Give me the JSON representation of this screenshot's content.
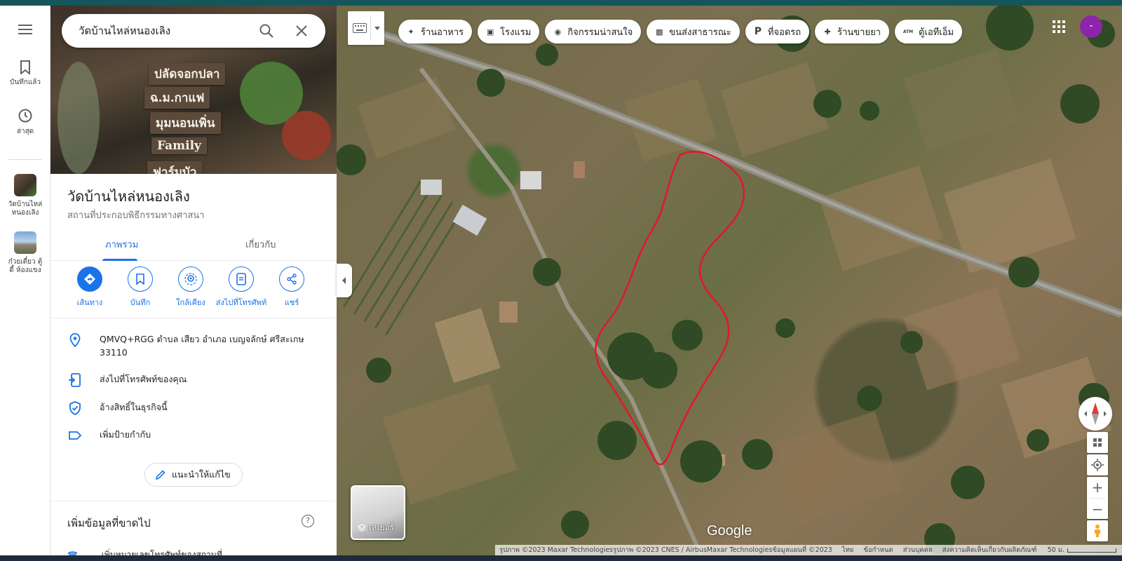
{
  "search": {
    "value": "วัดบ้านไหล่หนองเลิง"
  },
  "rail": {
    "saved_label": "บันทึกแล้ว",
    "recent_label": "ล่าสุด",
    "recent_items": [
      {
        "label_line1": "วัดบ้านไหล่",
        "label_line2": "หนองเลิง"
      },
      {
        "label_line1": "ก๋วยเตี๋ยว ตู้",
        "label_line2": "ดี้ ห้องแขง"
      }
    ]
  },
  "hero": {
    "signs": [
      "ปลัดจอกปลา",
      "ฉ.ม.กาแฟ",
      "มุมนอนเพิ่น",
      "Family",
      "ฟาร์มบัว"
    ]
  },
  "place": {
    "title": "วัดบ้านไหล่หนองเลิง",
    "category": "สถานที่ประกอบพิธีกรรมทางศาสนา"
  },
  "tabs": [
    {
      "label": "ภาพรวม",
      "active": true
    },
    {
      "label": "เกี่ยวกับ",
      "active": false
    }
  ],
  "actions": [
    {
      "label": "เส้นทาง",
      "icon": "directions-icon"
    },
    {
      "label": "บันทึก",
      "icon": "bookmark-icon"
    },
    {
      "label": "ใกล้เคียง",
      "icon": "nearby-icon"
    },
    {
      "label": "ส่งไปที่โทรศัพท์",
      "icon": "send-to-phone-icon"
    },
    {
      "label": "แชร์",
      "icon": "share-icon"
    }
  ],
  "info": {
    "address_line1": "QMVQ+RGG ตำบล เสียว อำเภอ เบญจลักษ์ ศรีสะเกษ",
    "address_line2": "33110",
    "send_to_phone": "ส่งไปที่โทรศัพท์ของคุณ",
    "claim": "อ้างสิทธิ์ในธุรกิจนี้",
    "add_label": "เพิ่มป้ายกำกับ"
  },
  "suggest_edit": "แนะนำให้แก้ไข",
  "missing_info": {
    "heading": "เพิ่มข้อมูลที่ขาดไป",
    "help": "?",
    "first_item": "เพิ่มหมายเลขโทรศัพท์ของสถานที่"
  },
  "chips": [
    {
      "label": "ร้านอาหาร",
      "icon": "restaurant-icon"
    },
    {
      "label": "โรงแรม",
      "icon": "hotel-icon"
    },
    {
      "label": "กิจกรรมน่าสนใจ",
      "icon": "camera-icon"
    },
    {
      "label": "ขนส่งสาธารณะ",
      "icon": "transit-icon"
    },
    {
      "label": "ที่จอดรถ",
      "icon": "parking-icon"
    },
    {
      "label": "ร้านขายยา",
      "icon": "pharmacy-icon"
    },
    {
      "label": "ตู้เอทีเอ็ม",
      "icon": "atm-icon",
      "badge": "ATM"
    }
  ],
  "avatar_initial": "-",
  "layers_label": "เลเยอร์",
  "google_logo": "Google",
  "attribution": {
    "imagery": "รูปภาพ ©2023 Maxar Technologiesรูปภาพ ©2023 CNES / AirbusMaxar Technologiesข้อมูลแผนที่ ©2023",
    "language": "ไทย",
    "terms": "ข้อกำหนด",
    "privacy": "ส่วนบุคคล",
    "feedback": "ส่งความคิดเห็นเกี่ยวกับผลิตภัณฑ์",
    "scale": "50 ม."
  },
  "colors": {
    "accent": "#1a73e8",
    "boundary": "#e3172c",
    "avatar": "#8e24aa"
  }
}
